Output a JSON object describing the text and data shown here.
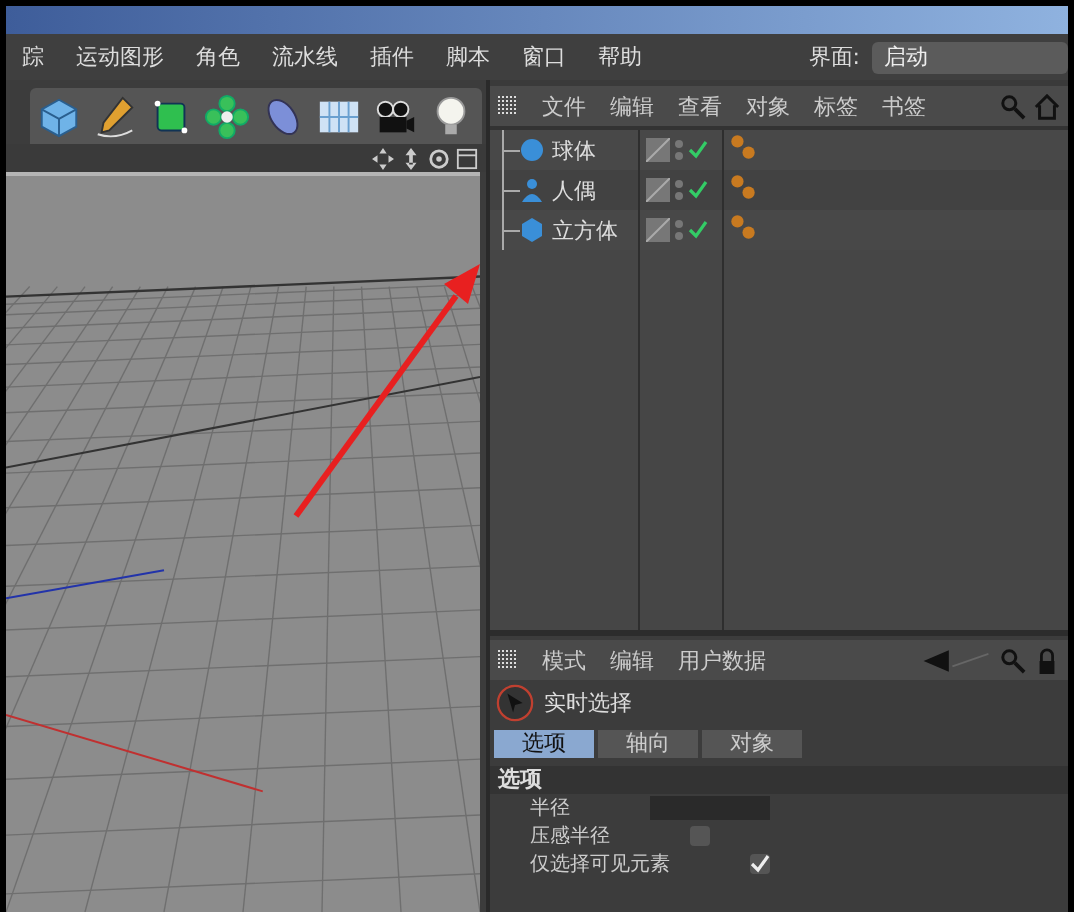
{
  "menu": [
    "踪",
    "运动图形",
    "角色",
    "流水线",
    "插件",
    "脚本",
    "窗口",
    "帮助"
  ],
  "layout": {
    "label": "界面:",
    "value": "启动"
  },
  "object_manager": {
    "menu": [
      "文件",
      "编辑",
      "查看",
      "对象",
      "标签",
      "书签"
    ],
    "objects": [
      {
        "name": "球体",
        "kind": "sphere",
        "enabled": true
      },
      {
        "name": "人偶",
        "kind": "figure",
        "enabled": true
      },
      {
        "name": "立方体",
        "kind": "cube",
        "enabled": true
      }
    ]
  },
  "attribute_manager": {
    "menu": [
      "模式",
      "编辑",
      "用户数据"
    ],
    "tool": "实时选择",
    "tabs": [
      {
        "label": "选项",
        "selected": true
      },
      {
        "label": "轴向",
        "selected": false
      },
      {
        "label": "对象",
        "selected": false
      }
    ],
    "section": "选项",
    "fields": [
      {
        "label": "半径",
        "kind": "number"
      },
      {
        "label": "压感半径",
        "kind": "checkbox",
        "checked": false
      },
      {
        "label": "仅选择可见元素",
        "kind": "checkbox",
        "checked": true
      }
    ]
  }
}
